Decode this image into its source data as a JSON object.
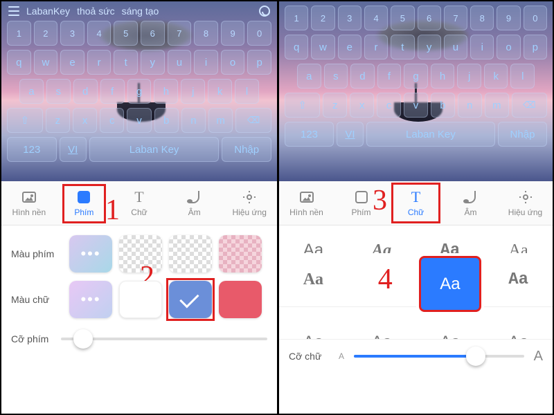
{
  "callouts": {
    "1": "1",
    "2": "2",
    "3": "3",
    "4": "4"
  },
  "left": {
    "topbar": {
      "brand": "LabanKey",
      "w1": "thoả sức",
      "w2": "sáng tạo"
    },
    "kb": {
      "nums": [
        "1",
        "2",
        "3",
        "4",
        "5",
        "6",
        "7",
        "8",
        "9",
        "0"
      ],
      "row1": [
        "q",
        "w",
        "e",
        "r",
        "t",
        "y",
        "u",
        "i",
        "o",
        "p"
      ],
      "row2": [
        "a",
        "s",
        "d",
        "f",
        "g",
        "h",
        "j",
        "k",
        "l"
      ],
      "row3": [
        "⇧",
        "z",
        "x",
        "c",
        "v",
        "b",
        "n",
        "m",
        "⌫"
      ],
      "bottom": {
        "k123": "123",
        "vi": "VI",
        "space": "Laban Key",
        "enter": "Nhập"
      }
    },
    "tabs": [
      {
        "label": "Hình nền"
      },
      {
        "label": "Phím"
      },
      {
        "label": "Chữ"
      },
      {
        "label": "Âm"
      },
      {
        "label": "Hiệu ứng"
      }
    ],
    "rows": {
      "mauphim": "Màu phím",
      "mauchu": "Màu chữ",
      "cophim": "Cỡ phím"
    }
  },
  "right": {
    "kb": {
      "nums": [
        "1",
        "2",
        "3",
        "4",
        "5",
        "6",
        "7",
        "8",
        "9",
        "0"
      ],
      "row1": [
        "q",
        "w",
        "e",
        "r",
        "t",
        "y",
        "u",
        "i",
        "o",
        "p"
      ],
      "row2": [
        "a",
        "s",
        "d",
        "f",
        "g",
        "h",
        "j",
        "k",
        "l"
      ],
      "row3": [
        "⇧",
        "z",
        "x",
        "c",
        "v",
        "b",
        "n",
        "m",
        "⌫"
      ],
      "bottom": {
        "k123": "123",
        "vi": "VI",
        "space": "Laban Key",
        "enter": "Nhập"
      }
    },
    "tabs": [
      {
        "label": "Hình nền"
      },
      {
        "label": "Phím"
      },
      {
        "label": "Chữ"
      },
      {
        "label": "Âm"
      },
      {
        "label": "Hiệu ứng"
      }
    ],
    "fonts": {
      "sample": "Aa",
      "slider_label": "Cỡ chữ",
      "ind_small": "A",
      "ind_big": "A"
    }
  }
}
